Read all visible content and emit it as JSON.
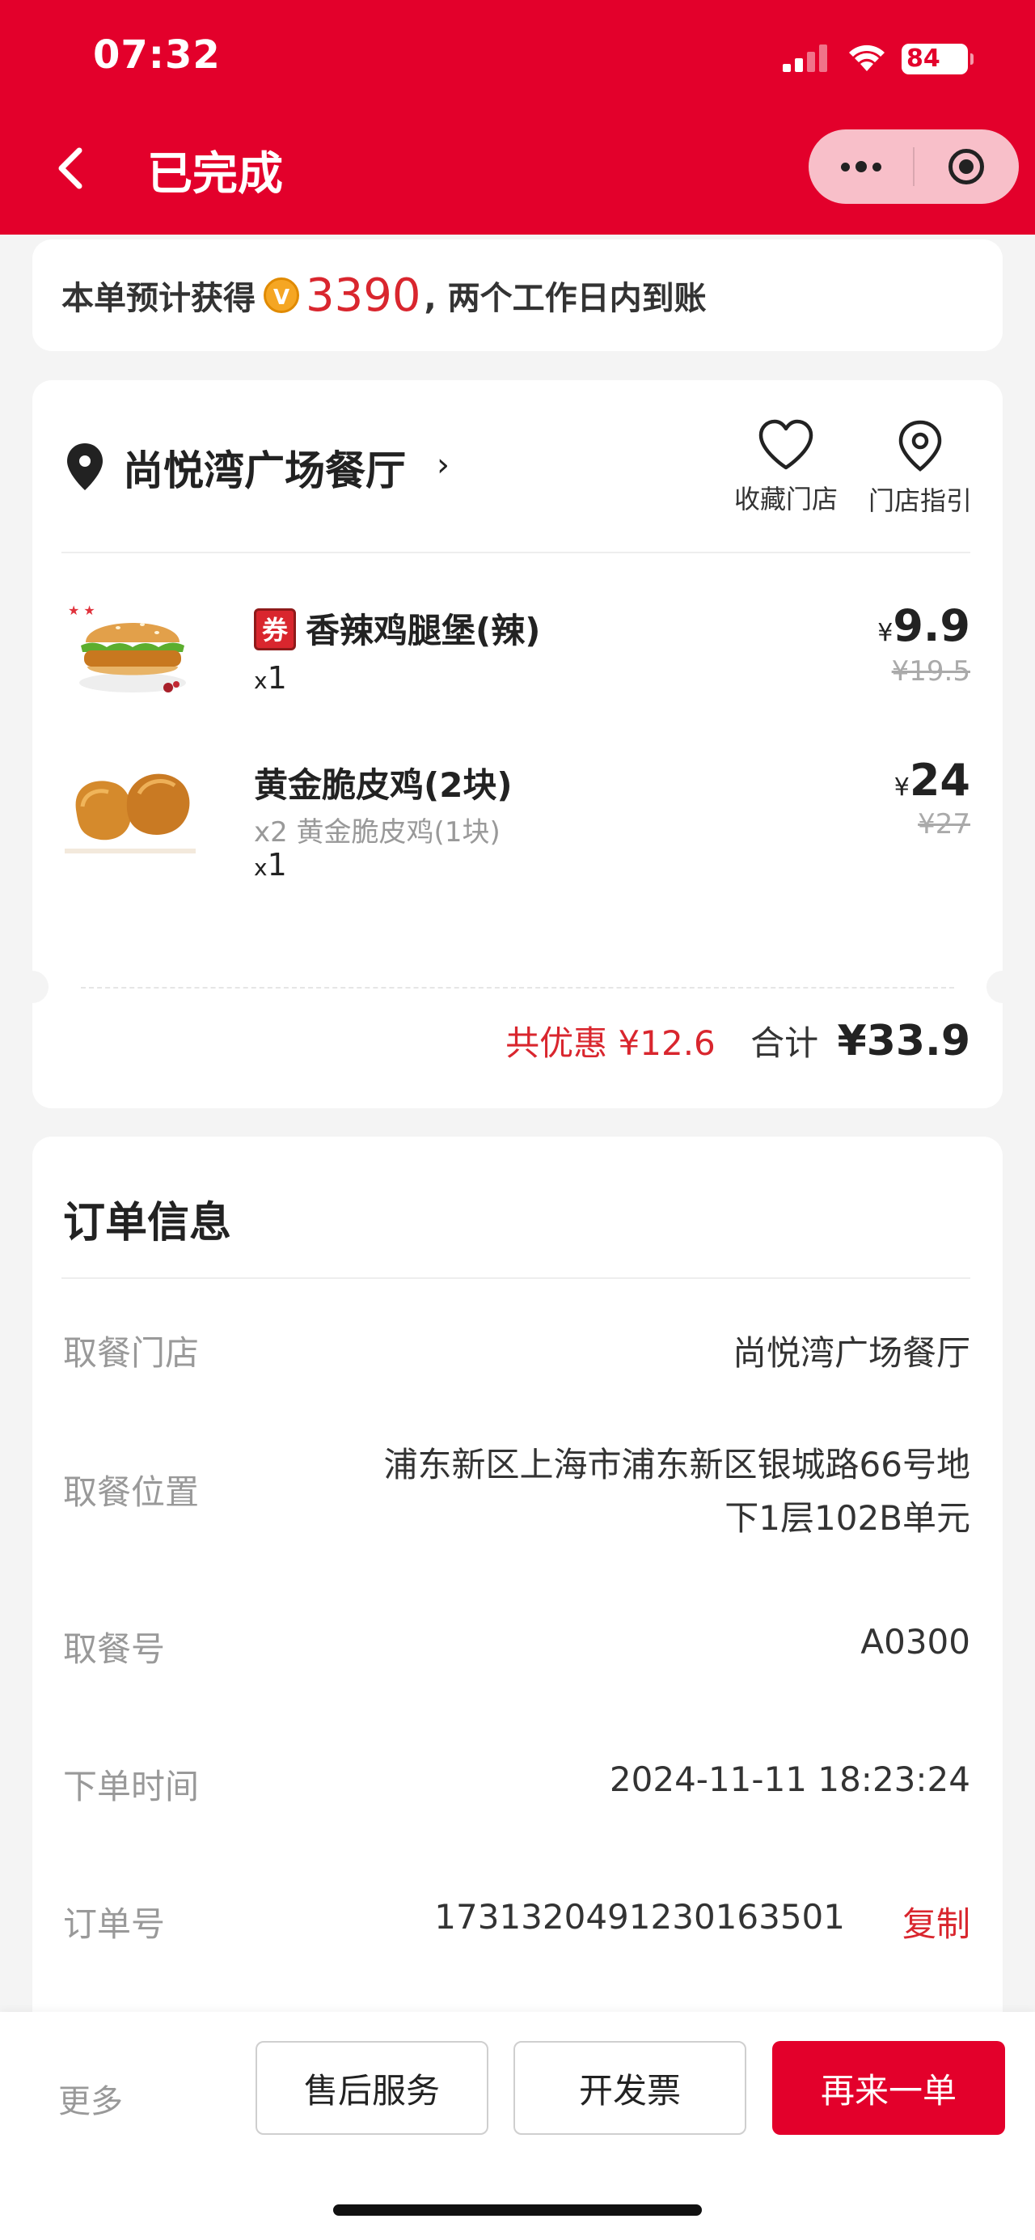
{
  "status_bar": {
    "time": "07:32",
    "battery": "84"
  },
  "nav": {
    "title": "已完成"
  },
  "points_banner": {
    "prefix": "本单预计获得",
    "coin_letter": "V",
    "amount": "3390",
    "suffix": ", 两个工作日内到账"
  },
  "store": {
    "name": "尚悦湾广场餐厅",
    "favorite_label": "收藏门店",
    "guide_label": "门店指引"
  },
  "items": [
    {
      "tag": "券",
      "name": "香辣鸡腿堡(辣)",
      "qty_prefix": "x",
      "qty": "1",
      "price_symbol": "¥",
      "price": "9.9",
      "original_price": "¥19.5"
    },
    {
      "name": "黄金脆皮鸡(2块)",
      "detail": "x2 黄金脆皮鸡(1块)",
      "qty_prefix": "x",
      "qty": "1",
      "price_symbol": "¥",
      "price": "24",
      "original_price": "¥27"
    }
  ],
  "totals": {
    "saved_label": "共优惠",
    "saved_value": "¥12.6",
    "total_label": "合计",
    "total_value": "¥33.9"
  },
  "order_info": {
    "title": "订单信息",
    "rows": [
      {
        "label": "取餐门店",
        "value": "尚悦湾广场餐厅"
      },
      {
        "label": "取餐位置",
        "value_line1": "浦东新区上海市浦东新区银城路66号地",
        "value_line2": "下1层102B单元"
      },
      {
        "label": "取餐号",
        "value": "A0300"
      },
      {
        "label": "下单时间",
        "value": "2024-11-11 18:23:24"
      },
      {
        "label": "订单号",
        "value": "1731320491230163501",
        "action": "复制"
      }
    ]
  },
  "bottom_bar": {
    "more": "更多",
    "after_sales": "售后服务",
    "invoice": "开发票",
    "reorder": "再来一单"
  },
  "colors": {
    "brand": "#e3002b",
    "accent_red": "#d9262e",
    "coin": "#f5a623"
  }
}
